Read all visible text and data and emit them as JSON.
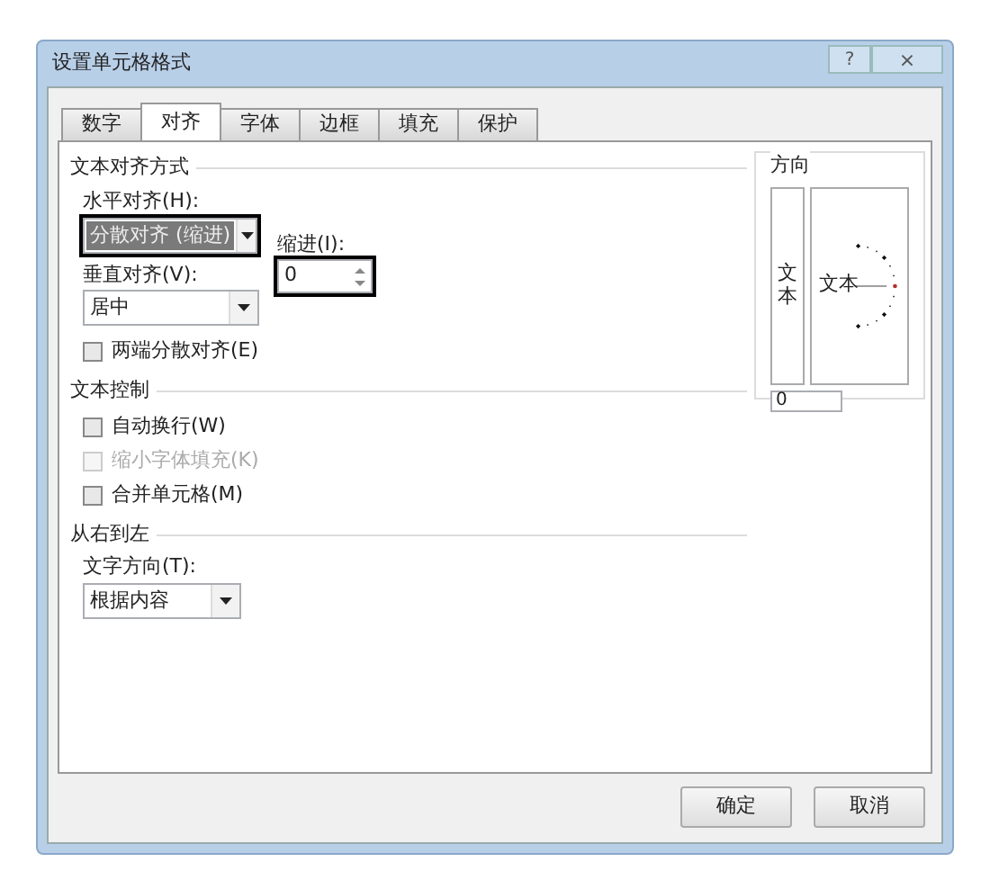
{
  "window": {
    "title": "设置单元格格式",
    "help": "?",
    "close": "×"
  },
  "tabs": [
    {
      "label": "数字",
      "selected": false
    },
    {
      "label": "对齐",
      "selected": true
    },
    {
      "label": "字体",
      "selected": false
    },
    {
      "label": "边框",
      "selected": false
    },
    {
      "label": "填充",
      "selected": false
    },
    {
      "label": "保护",
      "selected": false
    }
  ],
  "alignment": {
    "title": "文本对齐方式",
    "horizontal": {
      "label": "水平对齐(H):",
      "value": "分散对齐 (缩进)",
      "highlighted": true
    },
    "indent": {
      "label": "缩进(I):",
      "value": "0",
      "highlighted": true
    },
    "vertical": {
      "label": "垂直对齐(V):",
      "value": "居中"
    },
    "justify_distributed": {
      "label": "两端分散对齐(E)",
      "checked": false,
      "disabled": false
    }
  },
  "text_control": {
    "title": "文本控制",
    "options": [
      {
        "label": "自动换行(W)",
        "checked": false,
        "disabled": false
      },
      {
        "label": "缩小字体填充(K)",
        "checked": false,
        "disabled": true
      },
      {
        "label": "合并单元格(M)",
        "checked": false,
        "disabled": false
      }
    ]
  },
  "rtl": {
    "title": "从右到左",
    "direction": {
      "label": "文字方向(T):",
      "value": "根据内容"
    }
  },
  "orientation": {
    "title": "方向",
    "vertical_text": "文本",
    "rotated_text": "文本",
    "degrees": "0"
  },
  "buttons": [
    "确定",
    "取消"
  ]
}
